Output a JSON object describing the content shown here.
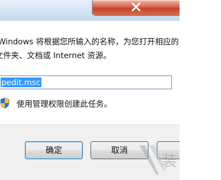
{
  "description": {
    "line1": "Windows 将根据您所输入的名称，为您打开相应的",
    "line2": "文件夹、文档或 Internet 资源。"
  },
  "input": {
    "value": "pedit.msc"
  },
  "admin_checkbox": {
    "label": "使用管理权限创建此任务。"
  },
  "buttons": {
    "ok": "确定",
    "cancel": "取消",
    "browse": "浏"
  },
  "watermark": {
    "text": "装"
  },
  "colors": {
    "selection": "#3399ff",
    "close_button": "#c4442b",
    "footer": "#f0f0f0"
  }
}
